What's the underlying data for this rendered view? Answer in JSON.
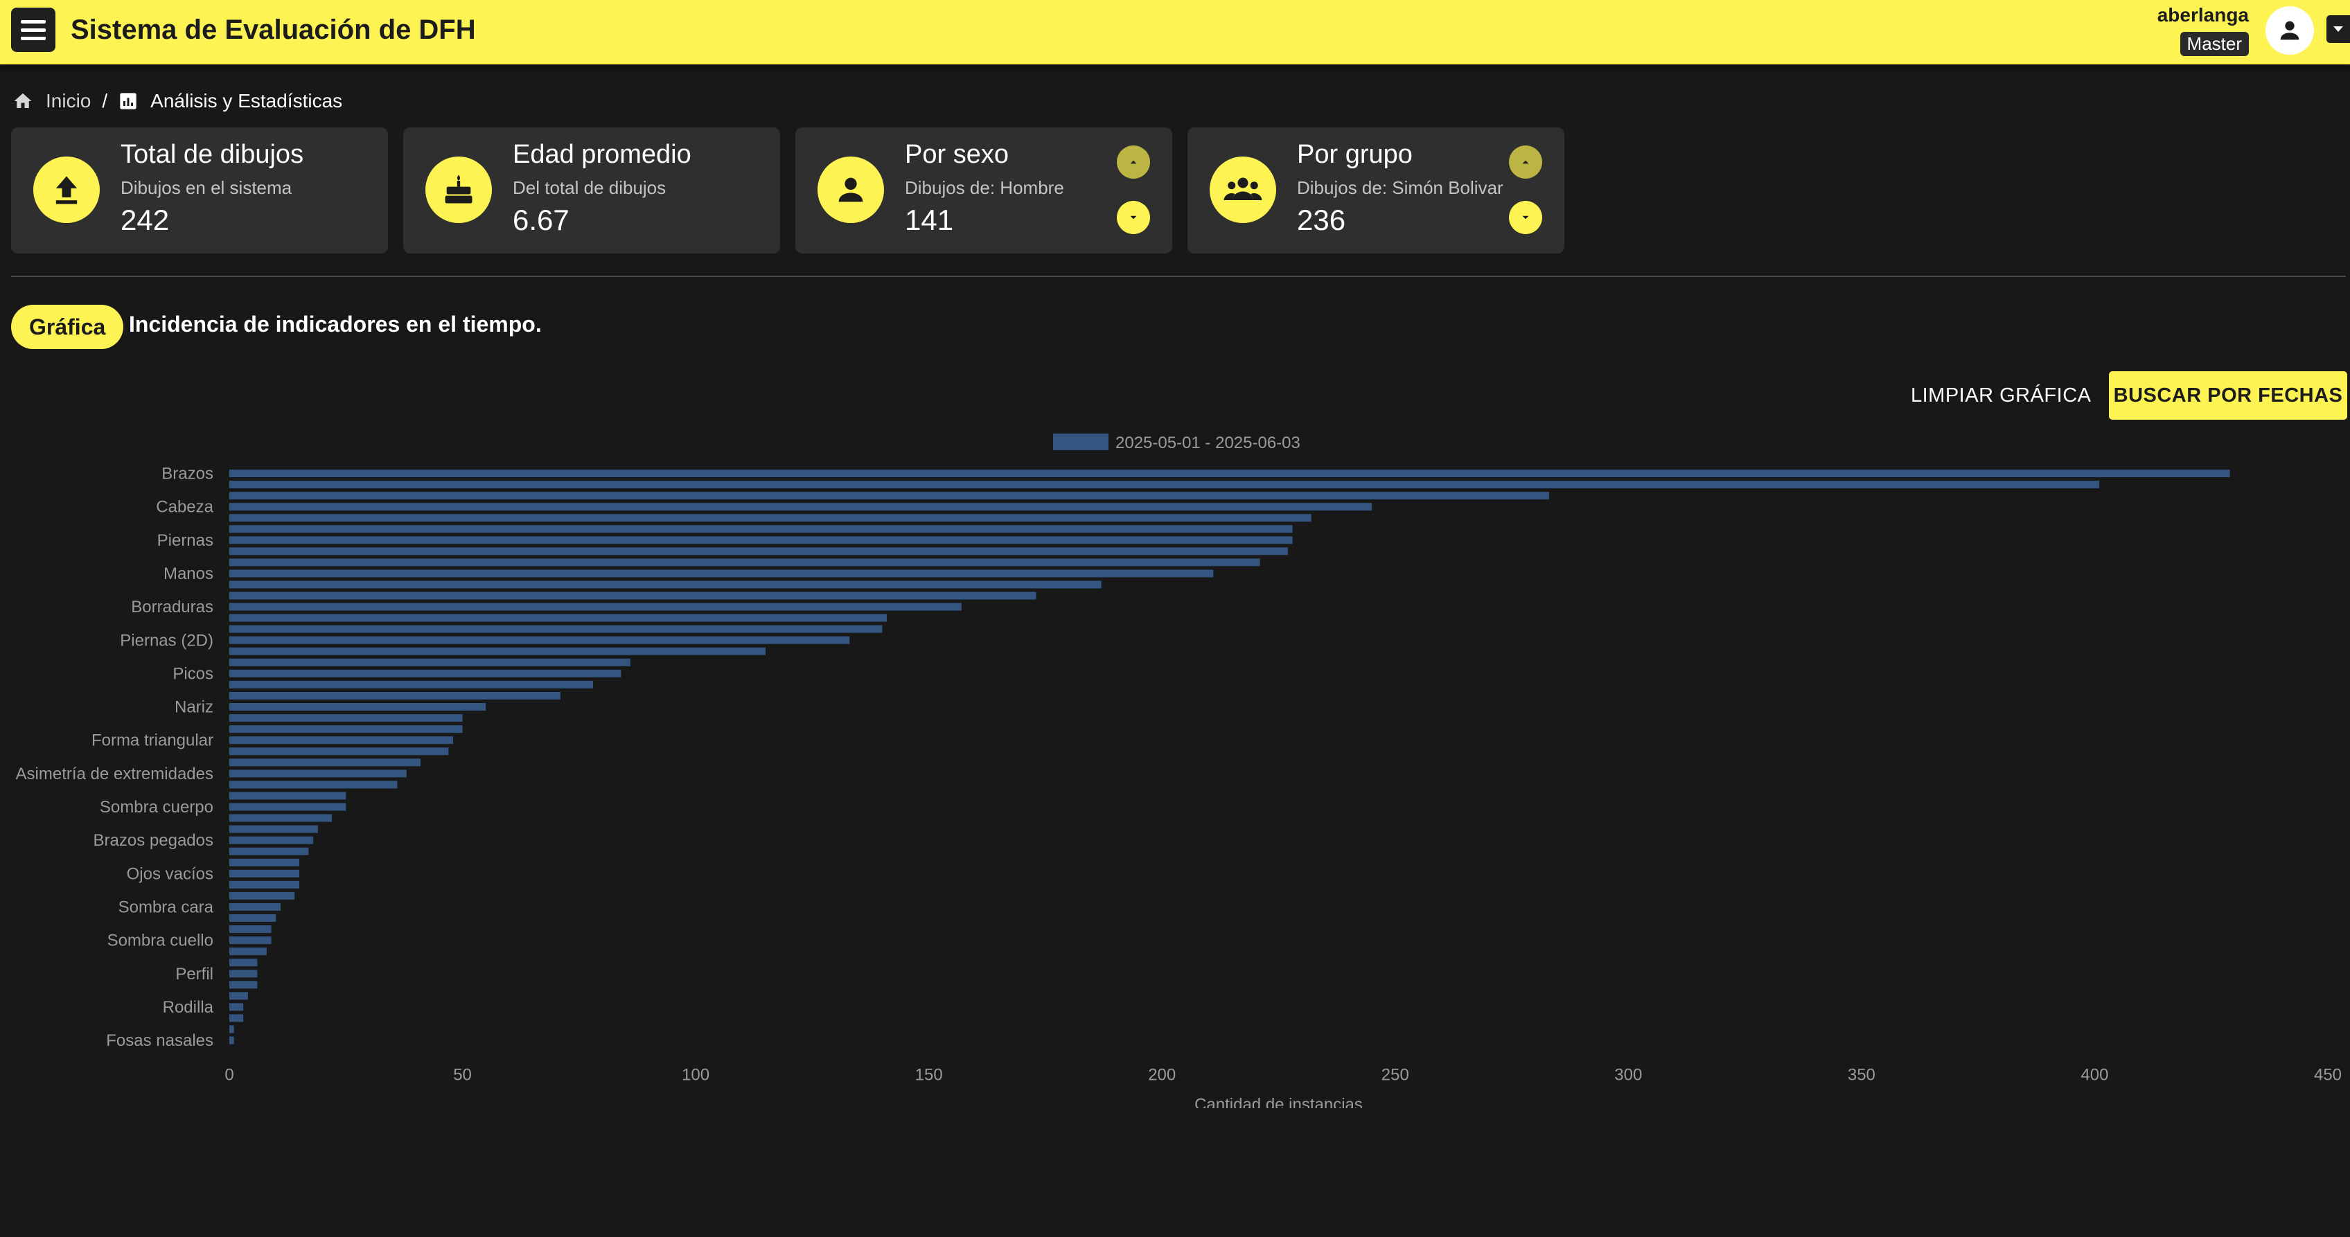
{
  "app": {
    "title": "Sistema de Evaluación de DFH",
    "user_name": "aberlanga",
    "user_role": "Master"
  },
  "icons": {
    "menu": "menu-icon",
    "avatar": "account-icon",
    "home": "home-icon",
    "stats": "chart-icon",
    "upload": "upload-icon",
    "cake": "cake-icon",
    "person": "person-icon",
    "group": "group-icon"
  },
  "colors": {
    "accent": "#fdf352",
    "background": "#181818",
    "card": "#2f2f2f",
    "bar": "#33557f"
  },
  "breadcrumb": {
    "home": "Inicio",
    "separator": "/",
    "current": "Análisis y Estadísticas"
  },
  "cards": [
    {
      "title": "Total de dibujos",
      "subtitle": "Dibujos en el sistema",
      "value": "242"
    },
    {
      "title": "Edad promedio",
      "subtitle": "Del total de dibujos",
      "value": "6.67"
    },
    {
      "title": "Por sexo",
      "subtitle": "Dibujos de: Hombre",
      "value": "141"
    },
    {
      "title": "Por grupo",
      "subtitle": "Dibujos de: Simón Bolivar",
      "value": "236"
    }
  ],
  "section": {
    "chip": "Gráfica",
    "title": "Incidencia de indicadores en el tiempo."
  },
  "actions": {
    "clear": "LIMPIAR GRÁFICA",
    "search": "BUSCAR POR FECHAS"
  },
  "chart_data": {
    "type": "bar",
    "orientation": "horizontal",
    "legend": "2025-05-01 - 2025-06-03",
    "legend_position": "top-center",
    "xlabel": "Cantidad de instancias",
    "xlim": [
      0,
      450
    ],
    "xticks": [
      0,
      50,
      100,
      150,
      200,
      250,
      300,
      350,
      400,
      450
    ],
    "category_labels": [
      "Brazos",
      "Cabeza",
      "Piernas",
      "Manos",
      "Borraduras",
      "Piernas (2D)",
      "Picos",
      "Nariz",
      "Forma triangular",
      "Asimetría de extremidades",
      "Sombra cuerpo",
      "Brazos pegados",
      "Ojos vacíos",
      "Sombra cara",
      "Sombra cuello",
      "Perfil",
      "Rodilla",
      "Fosas nasales"
    ],
    "label_every": 3,
    "series": [
      {
        "name": "2025-05-01 - 2025-06-03",
        "values": [
          429,
          401,
          283,
          245,
          232,
          228,
          228,
          227,
          221,
          211,
          187,
          173,
          157,
          141,
          140,
          133,
          115,
          86,
          84,
          78,
          71,
          55,
          50,
          50,
          48,
          47,
          41,
          38,
          36,
          25,
          25,
          22,
          19,
          18,
          17,
          15,
          15,
          15,
          14,
          11,
          10,
          9,
          9,
          8,
          6,
          6,
          6,
          4,
          3,
          3,
          1,
          1
        ]
      }
    ]
  }
}
